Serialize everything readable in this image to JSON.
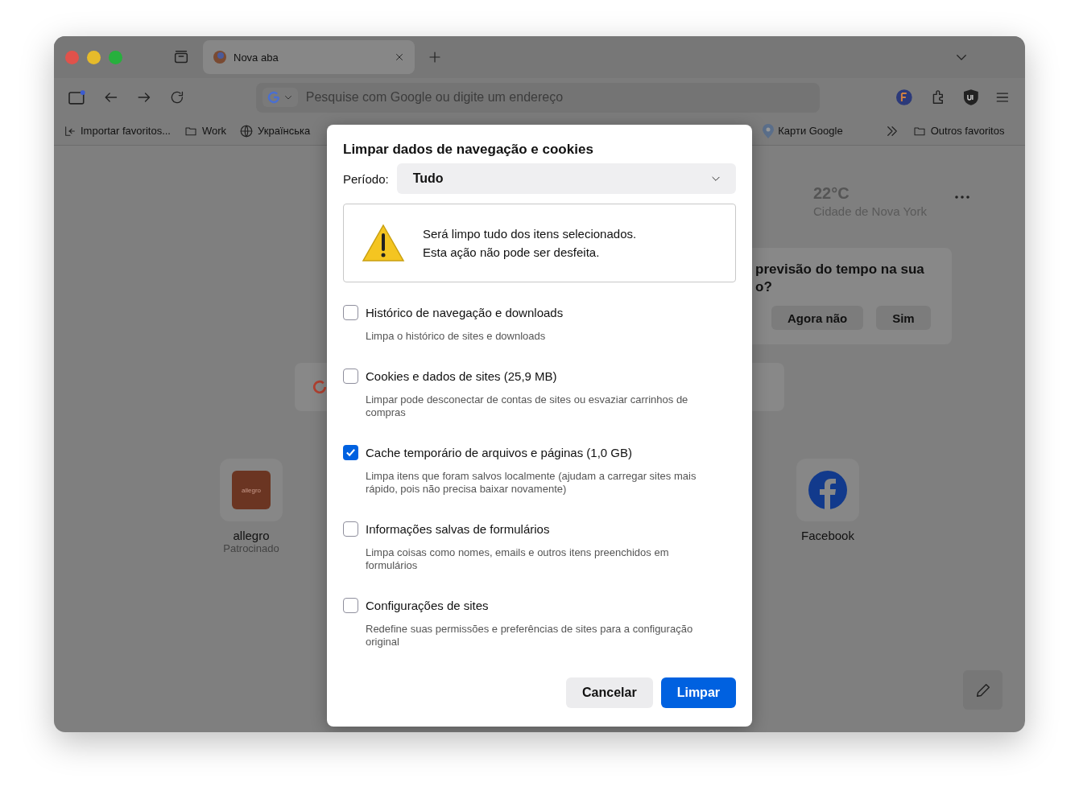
{
  "tabs": [
    {
      "title": "Nova aba",
      "selected": true
    }
  ],
  "address_bar": {
    "placeholder": "Pesquise com Google ou digite um endereço"
  },
  "bookmarks_left": [
    {
      "label": "Importar favoritos...",
      "kind": "import"
    },
    {
      "label": "Work",
      "kind": "folder"
    },
    {
      "label": "Українська",
      "kind": "globe"
    }
  ],
  "bookmarks_right": [
    {
      "label": "Карти Google",
      "kind": "maps"
    },
    {
      "label": "Outros favoritos",
      "kind": "folder"
    }
  ],
  "weather": {
    "temperature": "22°C",
    "city": "Cidade de Nova York"
  },
  "weather_prompt": {
    "lines": [
      "previsão do tempo na sua",
      "o?"
    ],
    "buttons": [
      "Agora não",
      "Sim"
    ]
  },
  "shortcuts": [
    {
      "label": "allegro",
      "sublabel": "Patrocinado",
      "logo_text": "allegro",
      "kind": "allegro"
    },
    {
      "label": "Facebook",
      "kind": "facebook"
    }
  ],
  "dialog": {
    "title": "Limpar dados de navegação e cookies",
    "period_label": "Período:",
    "period_value": "Tudo",
    "warning_lines": [
      "Será limpo tudo dos itens selecionados.",
      "Esta ação não pode ser desfeita."
    ],
    "options": [
      {
        "label": "Histórico de navegação e downloads",
        "description": "Limpa o histórico de sites e downloads",
        "checked": false
      },
      {
        "label": "Cookies e dados de sites (25,9 MB)",
        "description": "Limpar pode desconectar de contas de sites ou esvaziar carrinhos de compras",
        "checked": false
      },
      {
        "label": "Cache temporário de arquivos e páginas (1,0 GB)",
        "description": "Limpa itens que foram salvos localmente (ajudam a carregar sites mais rápido, pois não precisa baixar novamente)",
        "checked": true
      },
      {
        "label": "Informações salvas de formulários",
        "description": "Limpa coisas como nomes, emails e outros itens preenchidos em formulários",
        "checked": false
      },
      {
        "label": "Configurações de sites",
        "description": "Redefine suas permissões e preferências de sites para a configuração original",
        "checked": false
      }
    ],
    "buttons": [
      {
        "label": "Cancelar",
        "kind": "secondary"
      },
      {
        "label": "Limpar",
        "kind": "primary"
      }
    ]
  }
}
